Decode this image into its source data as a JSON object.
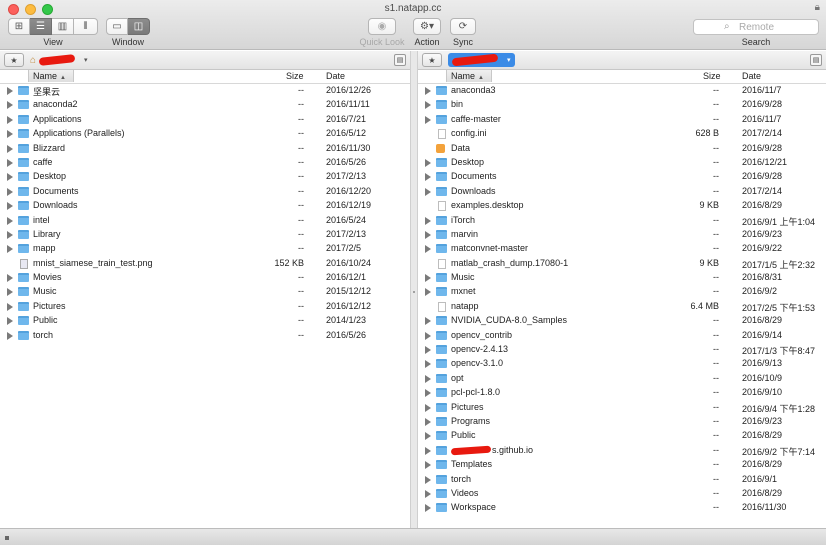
{
  "window": {
    "title": "s1.natapp.cc"
  },
  "toolbar": {
    "view_label": "View",
    "window_label": "Window",
    "quicklook_label": "Quick Look",
    "action_label": "Action",
    "sync_label": "Sync",
    "search_label": "Search",
    "search_placeholder": "Remote"
  },
  "columns": {
    "name": "Name",
    "size": "Size",
    "date": "Date"
  },
  "left_pane": {
    "rows": [
      {
        "name": "坚果云",
        "size": "--",
        "date": "2016/12/26",
        "type": "folder"
      },
      {
        "name": "anaconda2",
        "size": "--",
        "date": "2016/11/11",
        "type": "folder"
      },
      {
        "name": "Applications",
        "size": "--",
        "date": "2016/7/21",
        "type": "folder"
      },
      {
        "name": "Applications (Parallels)",
        "size": "--",
        "date": "2016/5/12",
        "type": "folder"
      },
      {
        "name": "Blizzard",
        "size": "--",
        "date": "2016/11/30",
        "type": "folder"
      },
      {
        "name": "caffe",
        "size": "--",
        "date": "2016/5/26",
        "type": "folder"
      },
      {
        "name": "Desktop",
        "size": "--",
        "date": "2017/2/13",
        "type": "folder"
      },
      {
        "name": "Documents",
        "size": "--",
        "date": "2016/12/20",
        "type": "folder"
      },
      {
        "name": "Downloads",
        "size": "--",
        "date": "2016/12/19",
        "type": "folder"
      },
      {
        "name": "intel",
        "size": "--",
        "date": "2016/5/24",
        "type": "folder"
      },
      {
        "name": "Library",
        "size": "--",
        "date": "2017/2/13",
        "type": "folder"
      },
      {
        "name": "mapp",
        "size": "--",
        "date": "2017/2/5",
        "type": "folder"
      },
      {
        "name": "mnist_siamese_train_test.png",
        "size": "152 KB",
        "date": "2016/10/24",
        "type": "image"
      },
      {
        "name": "Movies",
        "size": "--",
        "date": "2016/12/1",
        "type": "folder"
      },
      {
        "name": "Music",
        "size": "--",
        "date": "2015/12/12",
        "type": "folder"
      },
      {
        "name": "Pictures",
        "size": "--",
        "date": "2016/12/12",
        "type": "folder"
      },
      {
        "name": "Public",
        "size": "--",
        "date": "2014/1/23",
        "type": "folder"
      },
      {
        "name": "torch",
        "size": "--",
        "date": "2016/5/26",
        "type": "folder"
      }
    ]
  },
  "right_pane": {
    "rows": [
      {
        "name": "anaconda3",
        "size": "--",
        "date": "2016/11/7",
        "type": "folder"
      },
      {
        "name": "bin",
        "size": "--",
        "date": "2016/9/28",
        "type": "folder"
      },
      {
        "name": "caffe-master",
        "size": "--",
        "date": "2016/11/7",
        "type": "folder"
      },
      {
        "name": "config.ini",
        "size": "628 B",
        "date": "2017/2/14",
        "type": "file"
      },
      {
        "name": "Data",
        "size": "--",
        "date": "2016/9/28",
        "type": "alias"
      },
      {
        "name": "Desktop",
        "size": "--",
        "date": "2016/12/21",
        "type": "folder"
      },
      {
        "name": "Documents",
        "size": "--",
        "date": "2016/9/28",
        "type": "folder"
      },
      {
        "name": "Downloads",
        "size": "--",
        "date": "2017/2/14",
        "type": "folder"
      },
      {
        "name": "examples.desktop",
        "size": "9 KB",
        "date": "2016/8/29",
        "type": "file"
      },
      {
        "name": "iTorch",
        "size": "--",
        "date": "2016/9/1 上午1:04",
        "type": "folder"
      },
      {
        "name": "marvin",
        "size": "--",
        "date": "2016/9/23",
        "type": "folder"
      },
      {
        "name": "matconvnet-master",
        "size": "--",
        "date": "2016/9/22",
        "type": "folder"
      },
      {
        "name": "matlab_crash_dump.17080-1",
        "size": "9 KB",
        "date": "2017/1/5 上午2:32",
        "type": "file"
      },
      {
        "name": "Music",
        "size": "--",
        "date": "2016/8/31",
        "type": "folder"
      },
      {
        "name": "mxnet",
        "size": "--",
        "date": "2016/9/2",
        "type": "folder"
      },
      {
        "name": "natapp",
        "size": "6.4 MB",
        "date": "2017/2/5 下午1:53",
        "type": "file"
      },
      {
        "name": "NVIDIA_CUDA-8.0_Samples",
        "size": "--",
        "date": "2016/8/29",
        "type": "folder"
      },
      {
        "name": "opencv_contrib",
        "size": "--",
        "date": "2016/9/14",
        "type": "folder"
      },
      {
        "name": "opencv-2.4.13",
        "size": "--",
        "date": "2017/1/3 下午8:47",
        "type": "folder"
      },
      {
        "name": "opencv-3.1.0",
        "size": "--",
        "date": "2016/9/13",
        "type": "folder"
      },
      {
        "name": "opt",
        "size": "--",
        "date": "2016/10/9",
        "type": "folder"
      },
      {
        "name": "pcl-pcl-1.8.0",
        "size": "--",
        "date": "2016/9/10",
        "type": "folder"
      },
      {
        "name": "Pictures",
        "size": "--",
        "date": "2016/9/4 下午1:28",
        "type": "folder"
      },
      {
        "name": "Programs",
        "size": "--",
        "date": "2016/9/23",
        "type": "folder"
      },
      {
        "name": "Public",
        "size": "--",
        "date": "2016/8/29",
        "type": "folder"
      },
      {
        "name": "s.github.io",
        "size": "--",
        "date": "2016/9/2 下午7:14",
        "type": "folder",
        "redacted_prefix": true
      },
      {
        "name": "Templates",
        "size": "--",
        "date": "2016/8/29",
        "type": "folder"
      },
      {
        "name": "torch",
        "size": "--",
        "date": "2016/9/1",
        "type": "folder"
      },
      {
        "name": "Videos",
        "size": "--",
        "date": "2016/8/29",
        "type": "folder"
      },
      {
        "name": "Workspace",
        "size": "--",
        "date": "2016/11/30",
        "type": "folder"
      }
    ]
  },
  "icons": {
    "view_icons": "grid-icon",
    "view_list": "list-icon",
    "view_columns": "columns-icon",
    "view_coverflow": "coverflow-icon",
    "window_single": "single-pane-icon",
    "window_dual": "dual-pane-icon",
    "quicklook": "eye-icon",
    "action": "gear-icon",
    "sync": "sync-icon"
  },
  "colors": {
    "folder": "#6fb7ec",
    "selection": "#3b8be6",
    "redaction": "#e8190f"
  }
}
